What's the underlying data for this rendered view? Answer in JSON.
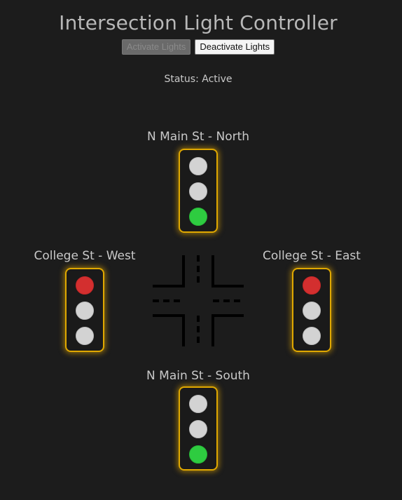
{
  "header": {
    "title": "Intersection Light Controller",
    "activate_label": "Activate Lights",
    "deactivate_label": "Deactivate Lights"
  },
  "status": {
    "text": "Status: Active"
  },
  "lights": {
    "north": {
      "label": "N Main St - North",
      "state": "green"
    },
    "west": {
      "label": "College St - West",
      "state": "red"
    },
    "east": {
      "label": "College St - East",
      "state": "red"
    },
    "south": {
      "label": "N Main St - South",
      "state": "green"
    }
  },
  "colors": {
    "background": "#1c1c1c",
    "frame": "#e0a800",
    "red": "#d32f2f",
    "green": "#2ecc40",
    "off": "#d3d3d3"
  }
}
